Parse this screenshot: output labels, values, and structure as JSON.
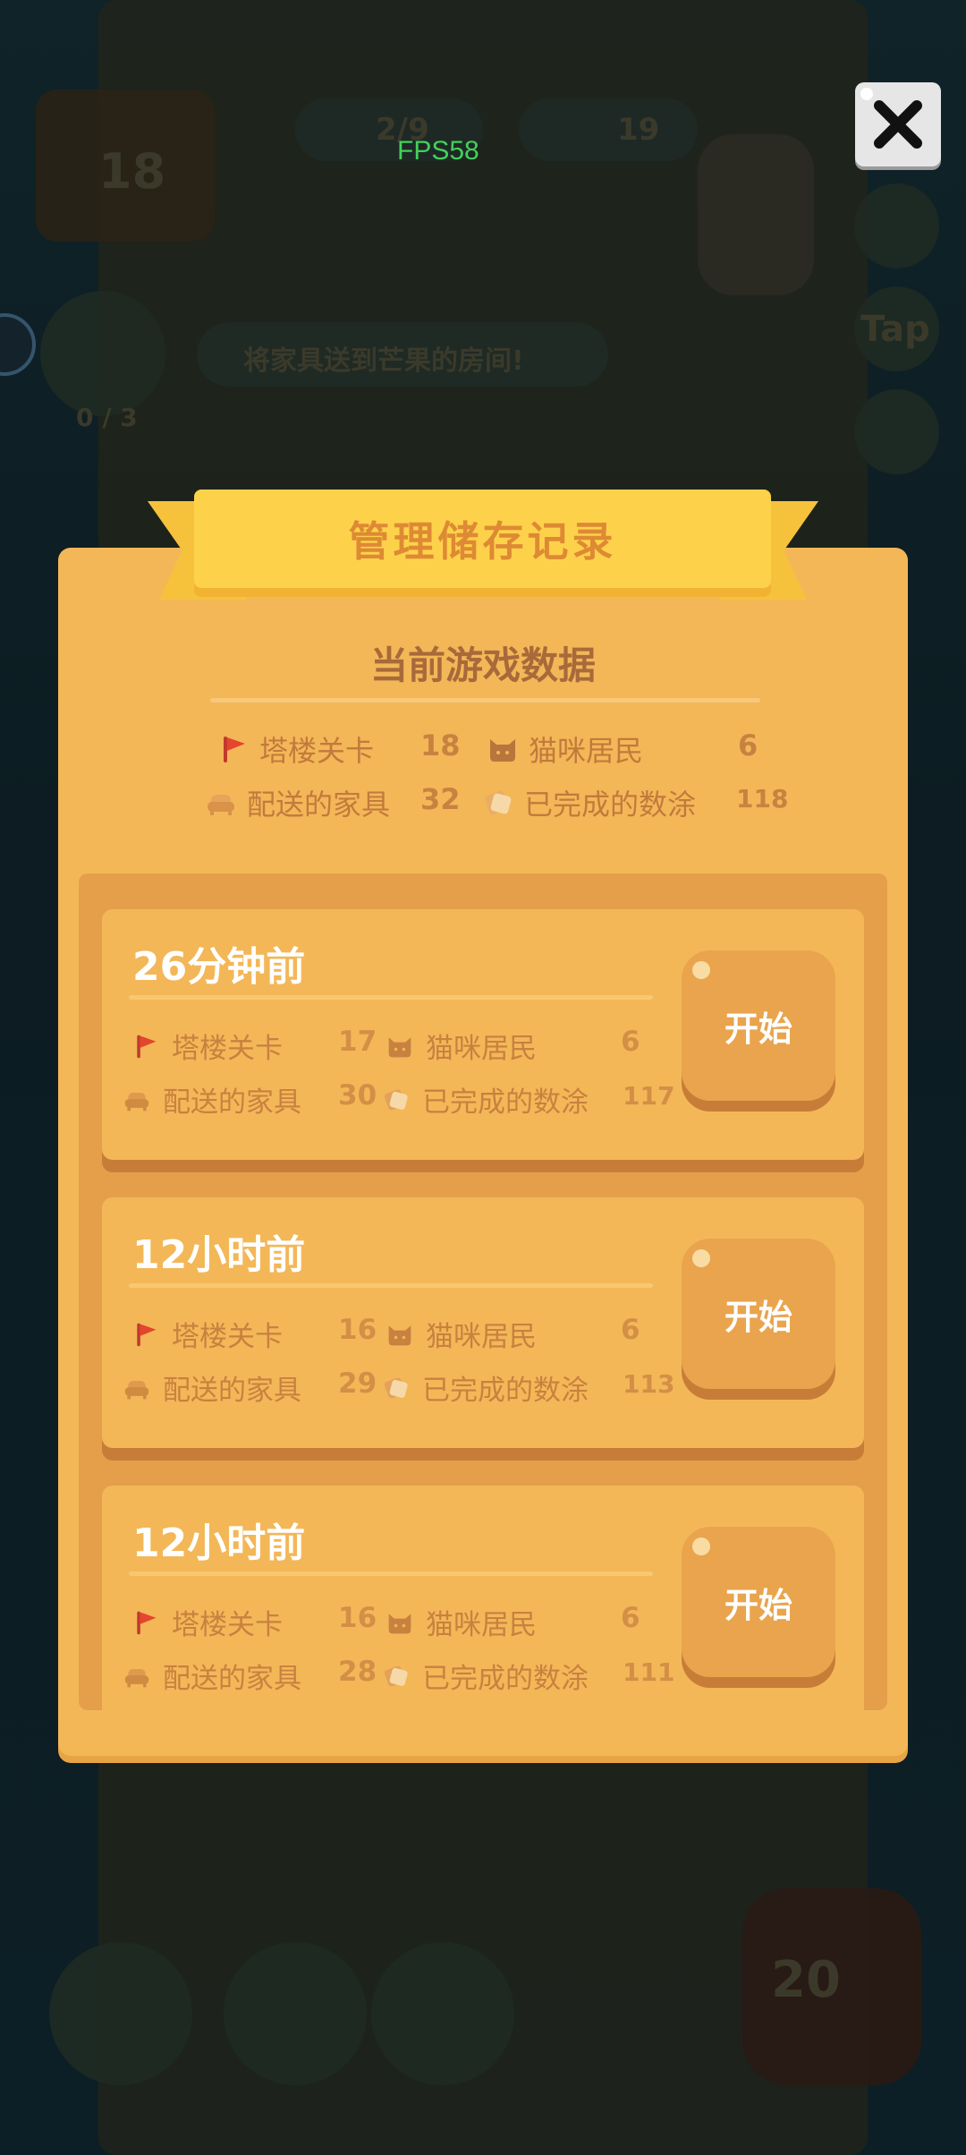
{
  "fps": "FPS58",
  "dialog": {
    "title": "管理储存记录",
    "current_title": "当前游戏数据",
    "current_stats": {
      "tower_label": "塔楼关卡",
      "tower_value": "18",
      "cats_label": "猫咪居民",
      "cats_value": "6",
      "furniture_label": "配送的家具",
      "furniture_value": "32",
      "paint_label": "已完成的数涂",
      "paint_value": "118"
    }
  },
  "saves": [
    {
      "time": "26分钟前",
      "tower_label": "塔楼关卡",
      "tower_value": "17",
      "cats_label": "猫咪居民",
      "cats_value": "6",
      "furniture_label": "配送的家具",
      "furniture_value": "30",
      "paint_label": "已完成的数涂",
      "paint_value": "117",
      "button": "开始"
    },
    {
      "time": "12小时前",
      "tower_label": "塔楼关卡",
      "tower_value": "16",
      "cats_label": "猫咪居民",
      "cats_value": "6",
      "furniture_label": "配送的家具",
      "furniture_value": "29",
      "paint_label": "已完成的数涂",
      "paint_value": "113",
      "button": "开始"
    },
    {
      "time": "12小时前",
      "tower_label": "塔楼关卡",
      "tower_value": "16",
      "cats_label": "猫咪居民",
      "cats_value": "6",
      "furniture_label": "配送的家具",
      "furniture_value": "28",
      "paint_label": "已完成的数涂",
      "paint_value": "111",
      "button": "开始"
    }
  ],
  "background": {
    "level_badge": "18",
    "hint_text": "将家具送到芒果的房间!",
    "progress": "0 / 3",
    "counter_a": "2/9",
    "counter_b": "19",
    "tap_label": "Tap",
    "bottom_level": "20"
  },
  "icons": {
    "flag": "flag-icon",
    "cat": "cat-icon",
    "sofa": "sofa-icon",
    "paint": "paint-icon",
    "close": "close-icon"
  },
  "colors": {
    "panel": "#f3b758",
    "ribbon": "#fdd24a",
    "title_text": "#de8a34",
    "flag": "#e4452f"
  }
}
